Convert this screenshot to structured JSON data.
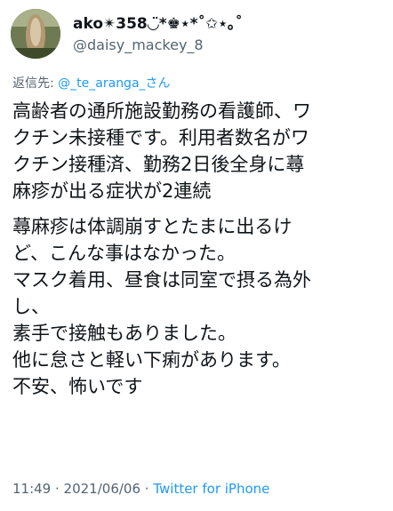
{
  "user": {
    "display_name": "ako✴︎358◡̈*♚⋆*˚✩⋆｡˚",
    "handle": "@daisy_mackey_8"
  },
  "reply": {
    "prefix": "返信先: ",
    "mention": "@_te_aranga_さん"
  },
  "tweet": {
    "paragraph1": [
      "高齢者の通所施設勤務の看護師、ワ",
      "クチン未接種です。利用者数名がワ",
      "クチン接種済、勤務2日後全身に蕁",
      "麻疹が出る症状が2連続"
    ],
    "paragraph2": [
      "蕁麻疹は体調崩すとたまに出るけ",
      "ど、こんな事はなかった。",
      "マスク着用、昼食は同室で摂る為外",
      "し、",
      "素手で接触もありました。",
      "他に怠さと軽い下痢があります。",
      "不安、怖いです"
    ]
  },
  "meta": {
    "time": "11:49",
    "separator1": " · ",
    "date": "2021/06/06",
    "separator2": " · ",
    "source": "Twitter for iPhone"
  },
  "colors": {
    "text": "#0f1419",
    "secondary": "#536471",
    "link": "#1d9bf0"
  }
}
